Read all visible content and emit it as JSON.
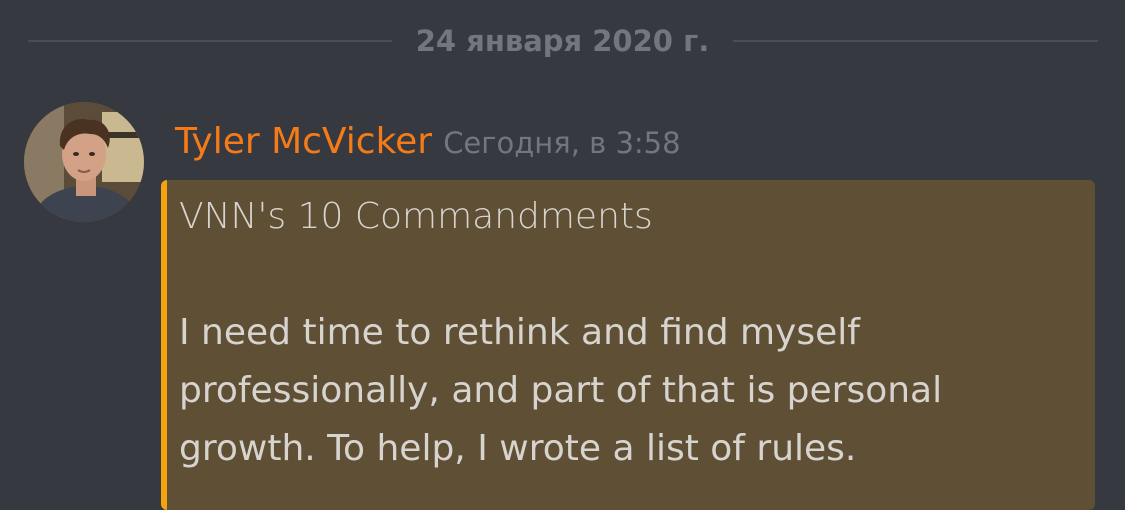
{
  "divider": {
    "date": "24 января 2020 г."
  },
  "message": {
    "author": "Tyler McVicker",
    "timestamp": "Сегодня, в 3:58",
    "avatar_alt": "Tyler McVicker avatar",
    "embed": {
      "accent_color": "#f4a30e",
      "background_color": "#5f4f35",
      "title": "VNN's 10 Commandments",
      "body_lines": [
        "I need time to rethink and find myself",
        "professionally, and part of that is personal",
        "growth. To help, I wrote a list of rules."
      ]
    }
  },
  "colors": {
    "background": "#36393f",
    "username": "#f47b17",
    "muted": "#72767d"
  }
}
